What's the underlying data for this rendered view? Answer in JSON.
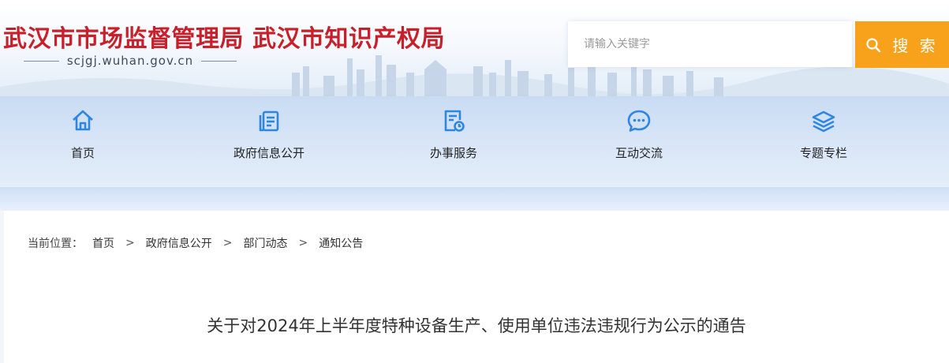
{
  "header": {
    "site_title": "武汉市市场监督管理局 武汉市知识产权局",
    "domain": "scjgj.wuhan.gov.cn"
  },
  "search": {
    "placeholder": "请输入关键字",
    "button_label": "搜 索"
  },
  "nav": {
    "items": [
      {
        "label": "首页",
        "icon": "home-icon"
      },
      {
        "label": "政府信息公开",
        "icon": "document-icon"
      },
      {
        "label": "办事服务",
        "icon": "service-icon"
      },
      {
        "label": "互动交流",
        "icon": "chat-icon"
      },
      {
        "label": "专题专栏",
        "icon": "layers-icon"
      }
    ]
  },
  "breadcrumb": {
    "lead": "当前位置：",
    "items": [
      "首页",
      "政府信息公开",
      "部门动态",
      "通知公告"
    ],
    "separator": ">"
  },
  "article": {
    "title": "关于对2024年上半年度特种设备生产、使用单位违法违规行为公示的通告"
  },
  "colors": {
    "title_red": "#c8202a",
    "search_orange": "#f7a21a",
    "icon_blue": "#2f86e0",
    "nav_bg": "#d3e2f6"
  }
}
